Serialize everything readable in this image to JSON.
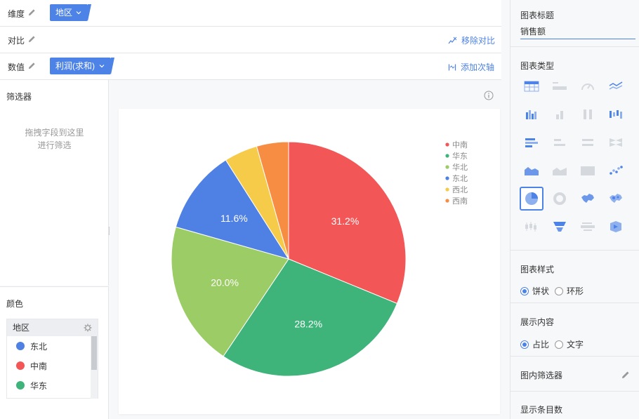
{
  "shelf": {
    "dimension": {
      "label": "维度",
      "chip": "地区"
    },
    "compare": {
      "label": "对比",
      "action": "移除对比"
    },
    "value": {
      "label": "数值",
      "chip": "利润(求和)",
      "action": "添加次轴"
    }
  },
  "filter_panel": {
    "title": "筛选器",
    "hint_line1": "拖拽字段到这里",
    "hint_line2": "进行筛选"
  },
  "color_panel": {
    "title": "颜色",
    "field": "地区",
    "legend": [
      {
        "label": "东北",
        "color": "#4f80e3"
      },
      {
        "label": "中南",
        "color": "#f25656"
      },
      {
        "label": "华东",
        "color": "#3eb37a"
      }
    ]
  },
  "chart_data": {
    "type": "pie",
    "title": "",
    "categories": [
      "中南",
      "华东",
      "华北",
      "东北",
      "西北",
      "西南"
    ],
    "values": [
      31.2,
      28.2,
      20.0,
      11.6,
      4.6,
      4.4
    ],
    "labels": [
      "31.2%",
      "28.2%",
      "20.0%",
      "11.6%",
      "",
      ""
    ],
    "colors": [
      "#f25656",
      "#3eb37a",
      "#9ccc65",
      "#4f80e3",
      "#f6cb4a",
      "#f78d42"
    ],
    "legend_position": "top-right"
  },
  "settings": {
    "chart_title_label": "图表标题",
    "chart_title_value": "销售额",
    "chart_type_label": "图表类型",
    "chart_style_label": "图表样式",
    "style_options": [
      "饼状",
      "环形"
    ],
    "style_selected": "饼状",
    "display_content_label": "展示内容",
    "content_options": [
      "占比",
      "文字"
    ],
    "content_selected": "占比",
    "inner_filter_label": "图内筛选器",
    "display_count_label": "显示条目数"
  },
  "colors": {
    "accent": "#4d82e6"
  }
}
